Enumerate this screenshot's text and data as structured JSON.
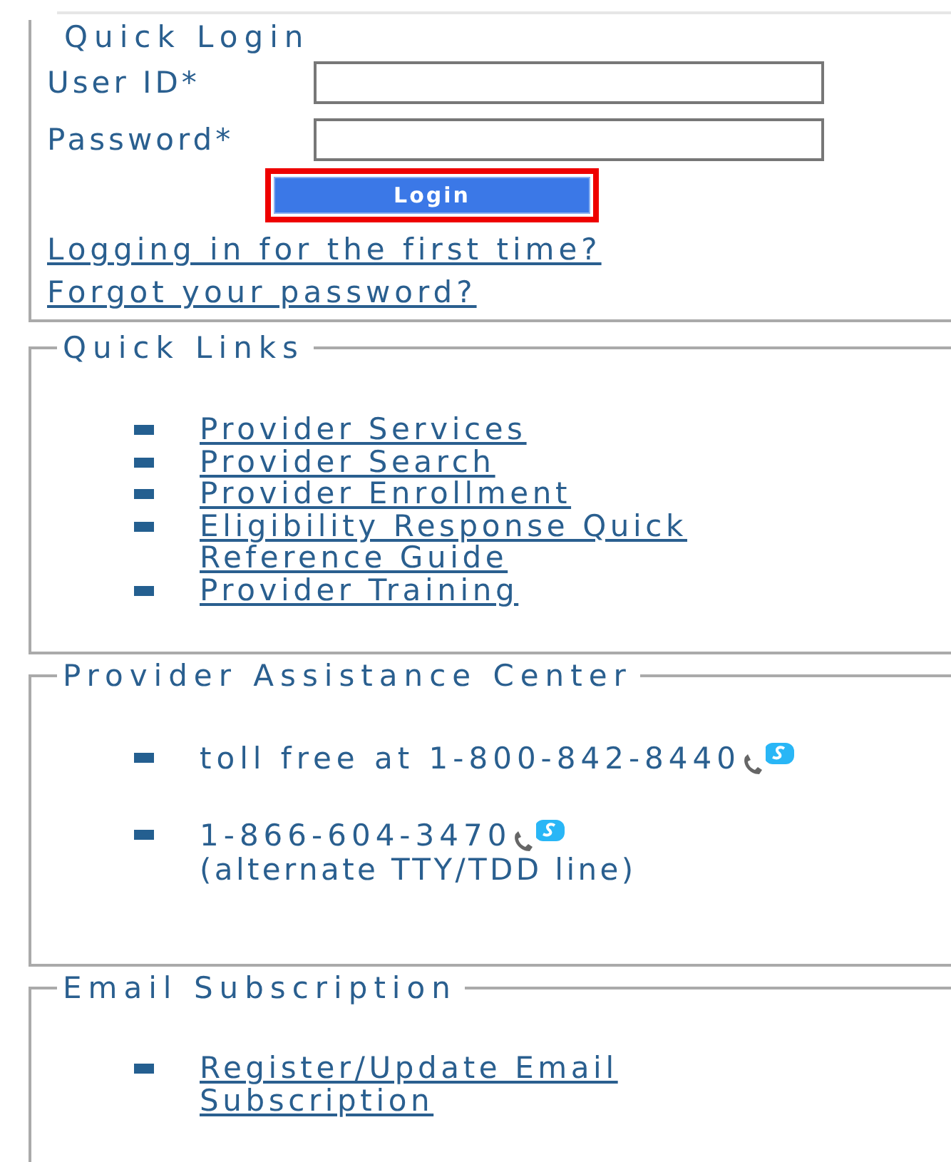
{
  "quick_login": {
    "title": "Quick Login",
    "fields": [
      {
        "label": "User ID*"
      },
      {
        "label": "Password*"
      }
    ],
    "login_button": "Login",
    "links": [
      "Logging in for the first time?",
      "Forgot your password?"
    ]
  },
  "sections": [
    {
      "title": "Quick Links",
      "items": [
        {
          "kind": "link",
          "text": "Provider Services"
        },
        {
          "kind": "link",
          "text": "Provider Search"
        },
        {
          "kind": "link",
          "text": "Provider Enrollment"
        },
        {
          "kind": "link",
          "text": "Eligibility Response Quick Reference Guide"
        },
        {
          "kind": "link",
          "text": "Provider Training"
        }
      ]
    },
    {
      "title": "Provider Assistance Center",
      "items": [
        {
          "kind": "phone",
          "text": "toll free at 1-800-842-8440"
        },
        {
          "kind": "phone",
          "text": "1-866-604-3470",
          "note": "(alternate TTY/TDD line)"
        }
      ]
    },
    {
      "title": "Email Subscription",
      "items": [
        {
          "kind": "link",
          "text": "Register/Update Email Subscription"
        }
      ]
    }
  ]
}
